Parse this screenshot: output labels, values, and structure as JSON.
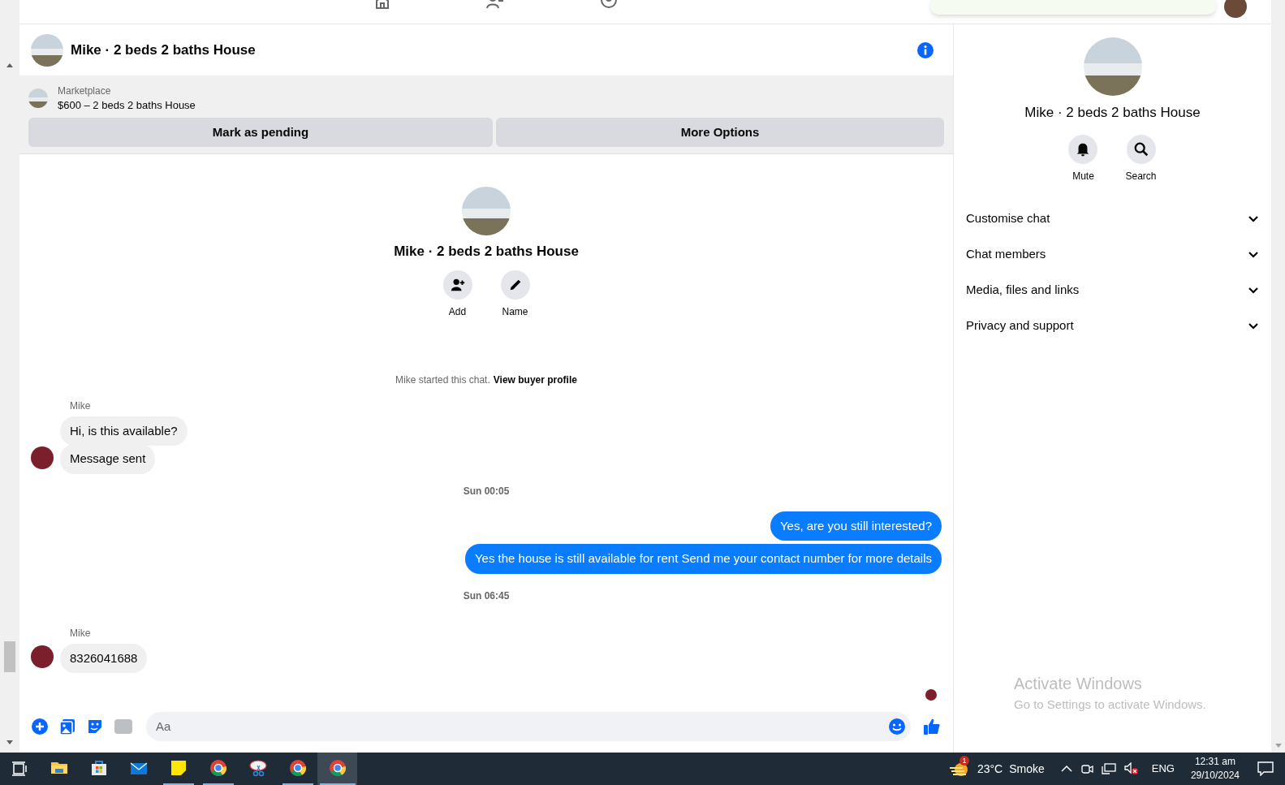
{
  "header": {
    "title": "Mike · 2 beds 2 baths House"
  },
  "listing": {
    "label": "Marketplace",
    "title": "$600 – 2 beds 2 baths House",
    "buttons": [
      "Mark as pending",
      "More Options"
    ]
  },
  "intro": {
    "title": "Mike · 2 beds 2 baths House",
    "actions": [
      {
        "kind": "add",
        "label": "Add"
      },
      {
        "kind": "name",
        "label": "Name"
      }
    ],
    "notice": "Mike started this chat.",
    "link": "View buyer profile"
  },
  "messages": [
    {
      "kind": "sender",
      "text": "Mike"
    },
    {
      "kind": "incoming",
      "text": "Hi, is this available?",
      "avatar": false
    },
    {
      "kind": "incoming",
      "text": "Message sent",
      "avatar": true
    },
    {
      "kind": "timestamp",
      "text": "Sun 00:05"
    },
    {
      "kind": "outgoing",
      "text": "Yes, are you still interested?"
    },
    {
      "kind": "outgoing",
      "text": "Yes the house is still available for rent Send me your contact number for more details"
    },
    {
      "kind": "timestamp",
      "text": "Sun 06:45"
    },
    {
      "kind": "sender",
      "text": "Mike"
    },
    {
      "kind": "incoming",
      "text": "8326041688",
      "avatar": true
    }
  ],
  "composer": {
    "placeholder": "Aa"
  },
  "side": {
    "title": "Mike · 2 beds 2 baths House",
    "actions": [
      {
        "kind": "mute",
        "label": "Mute"
      },
      {
        "kind": "search",
        "label": "Search"
      }
    ],
    "sections": [
      {
        "label": "Customise chat",
        "expanded": false
      },
      {
        "label": "Chat members",
        "expanded": false
      },
      {
        "label": "Media, files and links",
        "expanded": false
      },
      {
        "label": "Privacy and support",
        "expanded": false
      }
    ]
  },
  "activation": {
    "title": "Activate Windows",
    "subtitle": "Go to Settings to activate Windows."
  },
  "taskbar": {
    "apps": [
      {
        "kind": "explorer",
        "running": false,
        "selected": false
      },
      {
        "kind": "store",
        "running": false,
        "selected": false
      },
      {
        "kind": "mail",
        "running": false,
        "selected": false
      },
      {
        "kind": "notes",
        "running": true,
        "selected": false
      },
      {
        "kind": "chrome",
        "running": true,
        "selected": false
      },
      {
        "kind": "snip",
        "running": false,
        "selected": false
      },
      {
        "kind": "chrome",
        "running": true,
        "selected": false
      },
      {
        "kind": "chrome",
        "running": true,
        "selected": true
      }
    ],
    "weather": {
      "badge": "1",
      "temp": "23°C",
      "condition": "Smoke"
    },
    "language": "ENG",
    "time": "12:31 am",
    "date": "29/10/2024"
  }
}
